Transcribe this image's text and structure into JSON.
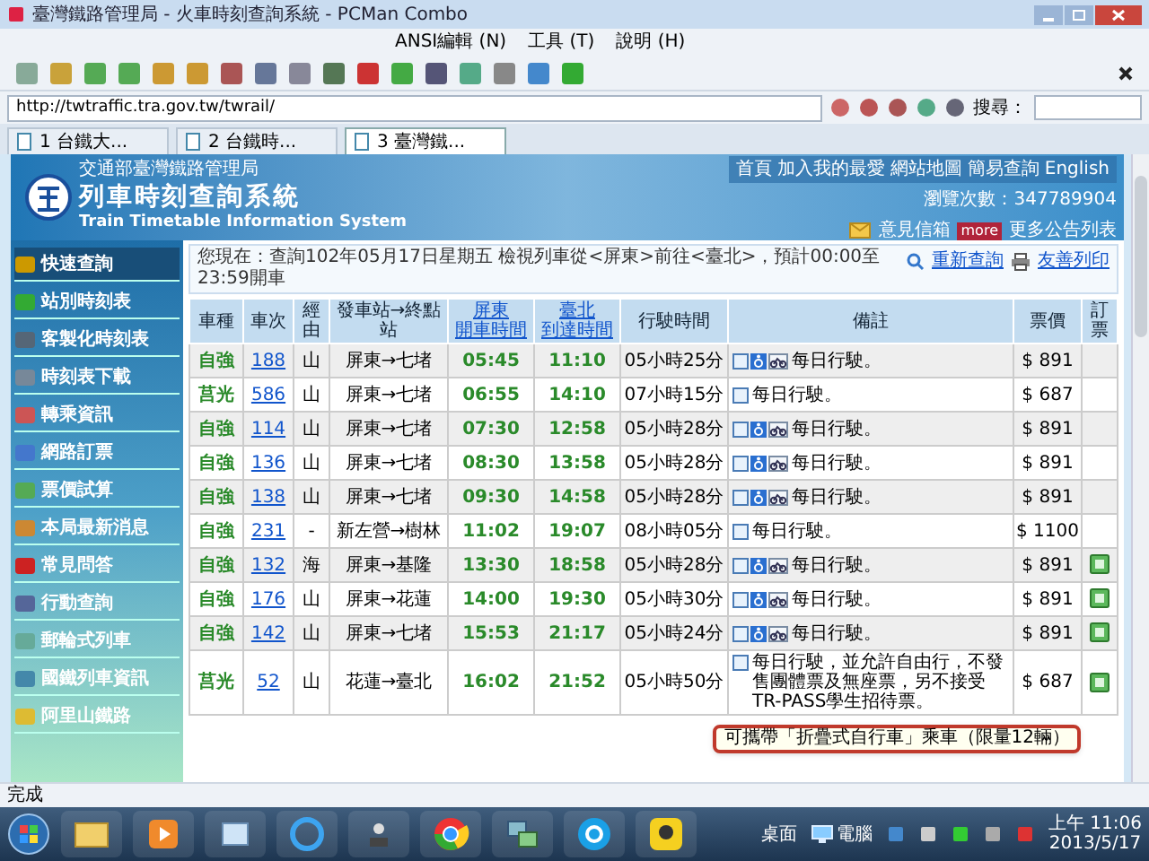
{
  "window": {
    "title": "臺灣鐵路管理局 - 火車時刻查詢系統 - PCMan Combo"
  },
  "menu": [
    "ANSI編輯 (N)",
    "工具 (T)",
    "說明 (H)"
  ],
  "address": "http://twtraffic.tra.gov.tw/twrail/",
  "search": {
    "label": "搜尋："
  },
  "tabs": [
    {
      "label": "1 台鐵大...",
      "selected": false
    },
    {
      "label": "2 台鐵時...",
      "selected": false
    },
    {
      "label": "3 臺灣鐵...",
      "selected": true
    }
  ],
  "site": {
    "agency": "交通部臺灣鐵路管理局",
    "title": "列車時刻查詢系統",
    "subtitle": "Train Timetable Information System",
    "links": [
      "首頁",
      "加入我的最愛",
      "網站地圖",
      "簡易查詢",
      "English"
    ],
    "counter": "瀏覽次數：347789904",
    "mailbox": "意見信箱",
    "more_badge": "more",
    "more": "更多公告列表"
  },
  "sidebar": [
    {
      "label": "快速查詢",
      "selected": true
    },
    {
      "label": "站別時刻表",
      "selected": false
    },
    {
      "label": "客製化時刻表",
      "selected": false
    },
    {
      "label": "時刻表下載",
      "selected": false
    },
    {
      "label": "轉乘資訊",
      "selected": false
    },
    {
      "label": "網路訂票",
      "selected": false
    },
    {
      "label": "票價試算",
      "selected": false
    },
    {
      "label": "本局最新消息",
      "selected": false
    },
    {
      "label": "常見問答",
      "selected": false
    },
    {
      "label": "行動查詢",
      "selected": false
    },
    {
      "label": "郵輪式列車",
      "selected": false
    },
    {
      "label": "國鐵列車資訊",
      "selected": false
    },
    {
      "label": "阿里山鐵路",
      "selected": false
    }
  ],
  "query": {
    "text": "您現在：查詢102年05月17日星期五 檢視列車從<屏東>前往<臺北>，預計00:00至23:59開車",
    "requery": "重新查詢",
    "print": "友善列印"
  },
  "table": {
    "columns": [
      "車種",
      "車次",
      "經由",
      "發車站→終點站",
      [
        "屏東",
        "開車時間"
      ],
      [
        "臺北",
        "到達時間"
      ],
      "行駛時間",
      "備註",
      "票價",
      "訂票"
    ],
    "rows": [
      {
        "type": "自強",
        "train": "188",
        "via": "山",
        "route": "屏東→七堵",
        "depart": "05:45",
        "arrive": "11:10",
        "duration": "05小時25分",
        "accessible": true,
        "bike": true,
        "note": "每日行駛。",
        "fare": "$ 891",
        "bookable": false
      },
      {
        "type": "莒光",
        "train": "586",
        "via": "山",
        "route": "屏東→七堵",
        "depart": "06:55",
        "arrive": "14:10",
        "duration": "07小時15分",
        "accessible": false,
        "bike": false,
        "note": "每日行駛。",
        "fare": "$ 687",
        "bookable": false
      },
      {
        "type": "自強",
        "train": "114",
        "via": "山",
        "route": "屏東→七堵",
        "depart": "07:30",
        "arrive": "12:58",
        "duration": "05小時28分",
        "accessible": true,
        "bike": true,
        "note": "每日行駛。",
        "fare": "$ 891",
        "bookable": false
      },
      {
        "type": "自強",
        "train": "136",
        "via": "山",
        "route": "屏東→七堵",
        "depart": "08:30",
        "arrive": "13:58",
        "duration": "05小時28分",
        "accessible": true,
        "bike": true,
        "note": "每日行駛。",
        "fare": "$ 891",
        "bookable": false
      },
      {
        "type": "自強",
        "train": "138",
        "via": "山",
        "route": "屏東→七堵",
        "depart": "09:30",
        "arrive": "14:58",
        "duration": "05小時28分",
        "accessible": true,
        "bike": true,
        "note": "每日行駛。",
        "fare": "$ 891",
        "bookable": false
      },
      {
        "type": "自強",
        "train": "231",
        "via": "-",
        "route": "新左營→樹林",
        "depart": "11:02",
        "arrive": "19:07",
        "duration": "08小時05分",
        "accessible": false,
        "bike": false,
        "note": "每日行駛。",
        "fare": "$ 1100",
        "bookable": false
      },
      {
        "type": "自強",
        "train": "132",
        "via": "海",
        "route": "屏東→基隆",
        "depart": "13:30",
        "arrive": "18:58",
        "duration": "05小時28分",
        "accessible": true,
        "bike": true,
        "note": "每日行駛。",
        "fare": "$ 891",
        "bookable": true
      },
      {
        "type": "自強",
        "train": "176",
        "via": "山",
        "route": "屏東→花蓮",
        "depart": "14:00",
        "arrive": "19:30",
        "duration": "05小時30分",
        "accessible": true,
        "bike": true,
        "note": "每日行駛。",
        "fare": "$ 891",
        "bookable": true
      },
      {
        "type": "自強",
        "train": "142",
        "via": "山",
        "route": "屏東→七堵",
        "depart": "15:53",
        "arrive": "21:17",
        "duration": "05小時24分",
        "accessible": true,
        "bike": true,
        "note": "每日行駛。",
        "fare": "$ 891",
        "bookable": true
      },
      {
        "type": "莒光",
        "train": "52",
        "via": "山",
        "route": "花蓮→臺北",
        "depart": "16:02",
        "arrive": "21:52",
        "duration": "05小時50分",
        "accessible": false,
        "bike": false,
        "note": "每日行駛，並允許自由行，不發售團體票及無座票，另不接受TR-PASS學生招待票。",
        "fare": "$ 687",
        "bookable": true
      }
    ]
  },
  "tooltip": "可攜帶「折疊式自行車」乘車（限量12輛）",
  "status_bar": "完成",
  "taskbar": {
    "desktop": "桌面",
    "computer": "電腦",
    "time": "上午 11:06",
    "date": "2013/5/17"
  }
}
